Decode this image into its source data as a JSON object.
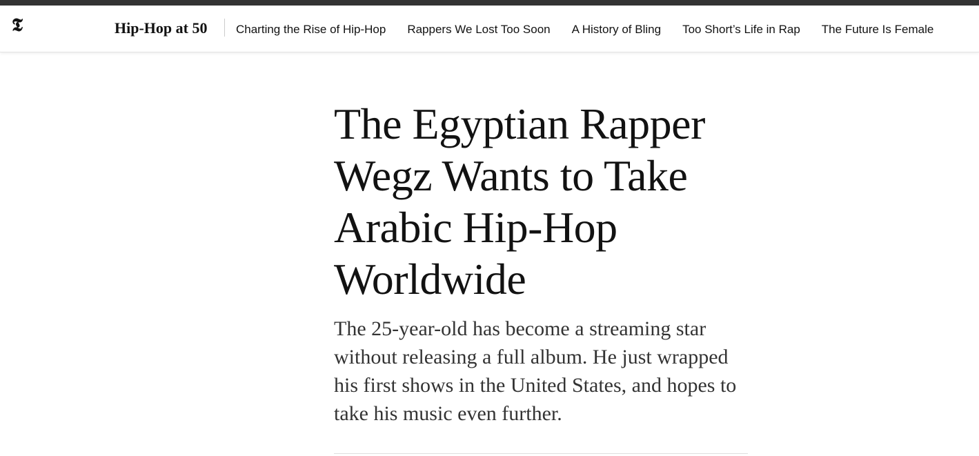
{
  "header": {
    "logo_text": "𝕿",
    "logo_icon": "nyt-t-logo-icon",
    "section_title": "Hip-Hop at 50",
    "nav_links": [
      "Charting the Rise of Hip-Hop",
      "Rappers We Lost Too Soon",
      "A History of Bling",
      "Too Short’s Life in Rap",
      "The Future Is Female"
    ]
  },
  "article": {
    "headline": "The Egyptian Rapper Wegz Wants to Take Arabic Hip-Hop Worldwide",
    "summary": "The 25-year-old has become a streaming star without releasing a full album. He just wrapped his first shows in the United States, and hopes to take his music even further."
  },
  "colors": {
    "top_bar": "#333333",
    "text": "#121212",
    "summary_text": "#333333",
    "background": "#ffffff"
  }
}
